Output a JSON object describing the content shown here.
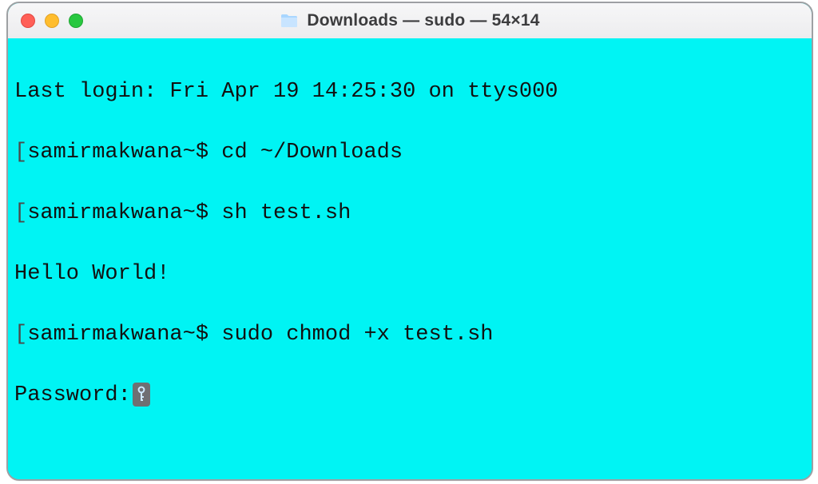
{
  "window": {
    "title": "Downloads — sudo — 54×14"
  },
  "terminal": {
    "last_login": "Last login: Fri Apr 19 14:25:30 on ttys000",
    "prompt_prefix": "samirmakwana~$ ",
    "cmd1": "cd ~/Downloads",
    "cmd2": "sh test.sh",
    "output1": "Hello World!",
    "cmd3": "sudo chmod +x test.sh",
    "password_label": "Password:",
    "bracket": "[",
    "colors": {
      "background": "#00f4f4",
      "text": "#111111"
    }
  }
}
